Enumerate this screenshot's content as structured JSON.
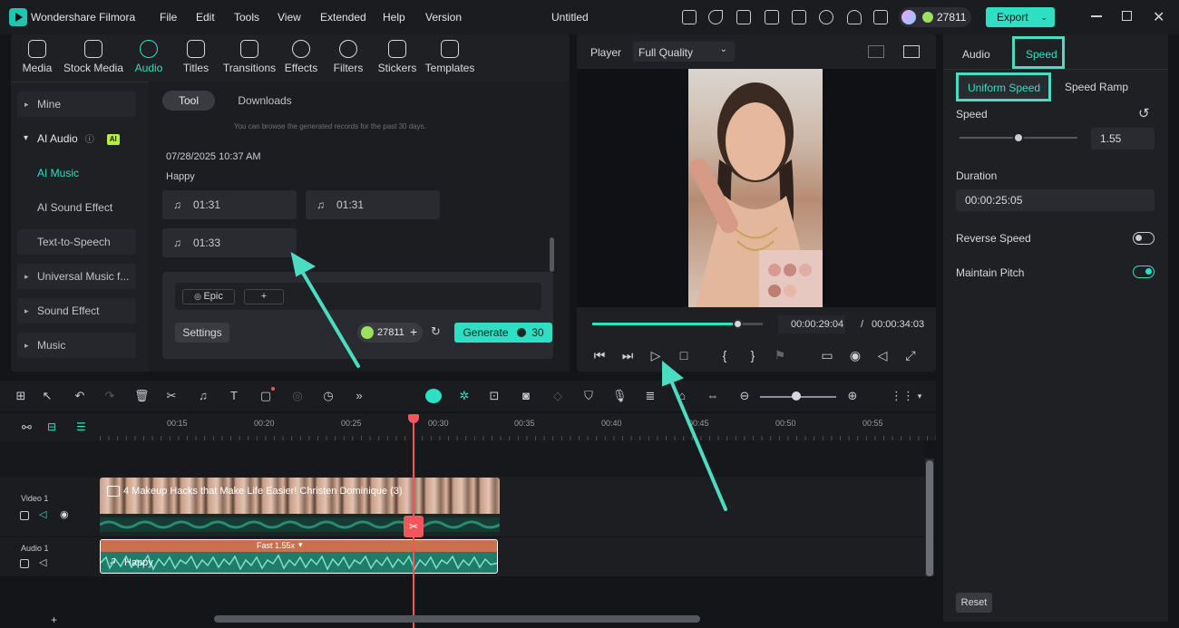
{
  "app": {
    "name": "Wondershare Filmora",
    "project_title": "Untitled",
    "menu": [
      "File",
      "Edit",
      "Tools",
      "View",
      "Extended",
      "Help",
      "Version"
    ],
    "credits": "27811",
    "export_label": "Export"
  },
  "media_tabs": [
    {
      "label": "Media",
      "icon": "media-icon"
    },
    {
      "label": "Stock Media",
      "icon": "stock-media-icon"
    },
    {
      "label": "Audio",
      "icon": "music-note-icon"
    },
    {
      "label": "Titles",
      "icon": "titles-icon"
    },
    {
      "label": "Transitions",
      "icon": "transitions-icon"
    },
    {
      "label": "Effects",
      "icon": "effects-icon"
    },
    {
      "label": "Filters",
      "icon": "filters-icon"
    },
    {
      "label": "Stickers",
      "icon": "stickers-icon"
    },
    {
      "label": "Templates",
      "icon": "templates-icon"
    }
  ],
  "sidebar": {
    "mine": "Mine",
    "ai_audio": "AI Audio",
    "ai_badge": "AI",
    "ai_music": "AI Music",
    "ai_sound_effect": "AI Sound Effect",
    "text_to_speech": "Text-to-Speech",
    "universal_music": "Universal Music f...",
    "sound_effect": "Sound Effect",
    "music": "Music"
  },
  "content": {
    "tab_tool": "Tool",
    "tab_downloads": "Downloads",
    "notice": "You can browse the generated records for the past 30 days.",
    "timestamp": "07/28/2025 10:37 AM",
    "group_name": "Happy",
    "clips": [
      "01:31",
      "01:31",
      "01:33"
    ],
    "chip_epic": "Epic",
    "chip_add": "+",
    "settings_label": "Settings",
    "credit_count": "27811",
    "generate_label": "Generate",
    "generate_cost": "30"
  },
  "player": {
    "label": "Player",
    "quality": "Full Quality",
    "current_time": "00:00:29:04",
    "separator": "/",
    "total_time": "00:00:34:03",
    "progress": 0.85
  },
  "properties": {
    "tab_audio": "Audio",
    "tab_speed": "Speed",
    "subtab_uniform": "Uniform Speed",
    "subtab_ramp": "Speed Ramp",
    "speed_label": "Speed",
    "speed_value": "1.55",
    "speed_fraction": 0.5,
    "duration_label": "Duration",
    "duration_value": "00:00:25:05",
    "reverse_label": "Reverse Speed",
    "reverse_on": false,
    "pitch_label": "Maintain Pitch",
    "pitch_on": true,
    "reset_label": "Reset"
  },
  "timeline": {
    "ruler": [
      "00:15",
      "00:20",
      "00:25",
      "00:30",
      "00:35",
      "00:40",
      "00:45",
      "00:50",
      "00:55"
    ],
    "video_track": "Video 1",
    "audio_track": "Audio 1",
    "video_clip_title": "4 Makeup Hacks that Make Life Easier! Christen Dominique (3)",
    "speed_badge": "Fast 1.55x",
    "audio_clip_title": "Happy",
    "add_track": "+"
  },
  "colors": {
    "accent": "#2de0c3",
    "highlight": "#4cdcc2",
    "playhead": "#f0575c",
    "audio_clip": "#1f7b6a",
    "speed_bar": "#c9704f"
  }
}
